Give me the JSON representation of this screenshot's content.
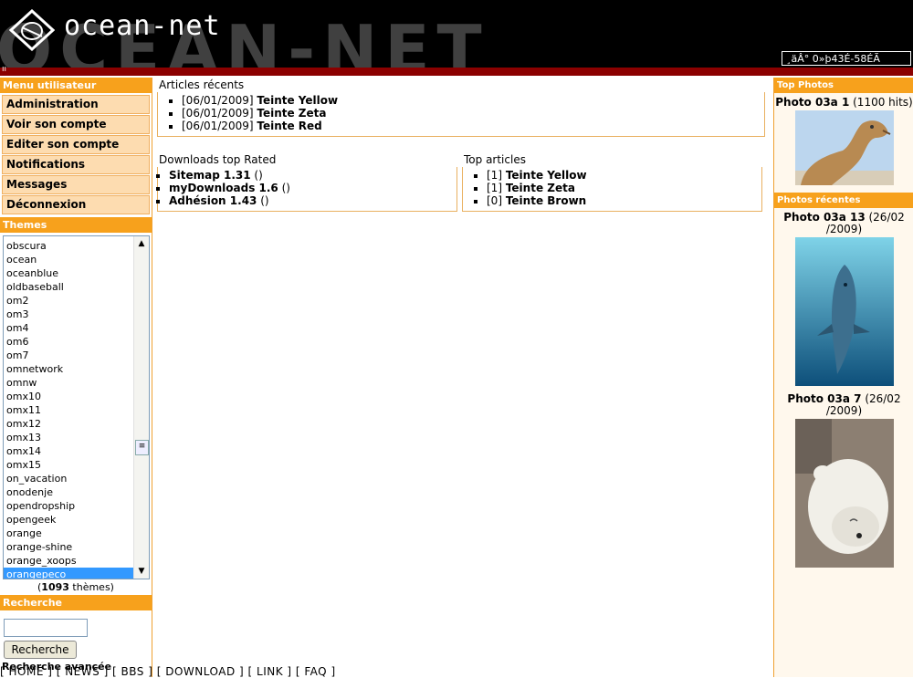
{
  "header": {
    "brand": "ocean-net",
    "background_word": "OCEAN-NET",
    "box_text": "¸äÂ° 0»þ43É-58ÉÃ",
    "bar_mark": "ıı"
  },
  "user_menu": {
    "title": "Menu utilisateur",
    "items": [
      {
        "label": "Administration"
      },
      {
        "label": "Voir son compte"
      },
      {
        "label": "Editer son compte"
      },
      {
        "label": "Notifications"
      },
      {
        "label": "Messages"
      },
      {
        "label": "Déconnexion"
      }
    ]
  },
  "themes": {
    "title": "Themes",
    "items": [
      "obscura",
      "ocean",
      "oceanblue",
      "oldbaseball",
      "om2",
      "om3",
      "om4",
      "om6",
      "om7",
      "omnetwork",
      "omnw",
      "omx10",
      "omx11",
      "omx12",
      "omx13",
      "omx14",
      "omx15",
      "on_vacation",
      "onodenje",
      "opendropship",
      "opengeek",
      "orange",
      "orange-shine",
      "orange_xoops",
      "orangepeco"
    ],
    "selected": "orangepeco",
    "count": "1093",
    "count_suffix": " thèmes)",
    "count_prefix": "("
  },
  "search": {
    "title": "Recherche",
    "input_value": "",
    "button_label": "Recherche",
    "advanced_label": "Recherche avancée"
  },
  "footer_links": "[ HOME ] [ NEWS ] [ BBS ] [ DOWNLOAD ] [ LINK ] [ FAQ ]",
  "recent_articles": {
    "title": "Articles récents",
    "items": [
      {
        "date": "[06/01/2009]",
        "name": "Teinte Yellow"
      },
      {
        "date": "[06/01/2009]",
        "name": "Teinte Zeta"
      },
      {
        "date": "[06/01/2009]",
        "name": "Teinte Red"
      }
    ]
  },
  "downloads": {
    "title": "Downloads top Rated",
    "items": [
      {
        "name": "Sitemap 1.31",
        "suffix": " ()"
      },
      {
        "name": "myDownloads 1.6",
        "suffix": " ()"
      },
      {
        "name": "Adhésion 1.43",
        "suffix": " ()"
      }
    ]
  },
  "top_articles": {
    "title": "Top articles",
    "items": [
      {
        "count": "[1]",
        "name": "Teinte Yellow"
      },
      {
        "count": "[1]",
        "name": "Teinte Zeta"
      },
      {
        "count": "[0]",
        "name": "Teinte Brown"
      }
    ]
  },
  "top_photos": {
    "title": "Top Photos",
    "items": [
      {
        "name": "Photo 03a 1",
        "meta": " (1100 hits)",
        "image": "camel"
      }
    ]
  },
  "recent_photos": {
    "title": "Photos récentes",
    "items": [
      {
        "name": "Photo 03a 13",
        "meta": " (26/02 /2009)",
        "image": "dolphin"
      },
      {
        "name": "Photo 03a 7",
        "meta": " (26/02 /2009)",
        "image": "polar-bear"
      }
    ]
  },
  "colors": {
    "header_bg": "#000000",
    "accent": "#f7a11c",
    "red_bar": "#8b0000",
    "menu_item_bg": "#fddcb0",
    "selected_bg": "#3399ff",
    "right_bg": "#fff8ed"
  }
}
